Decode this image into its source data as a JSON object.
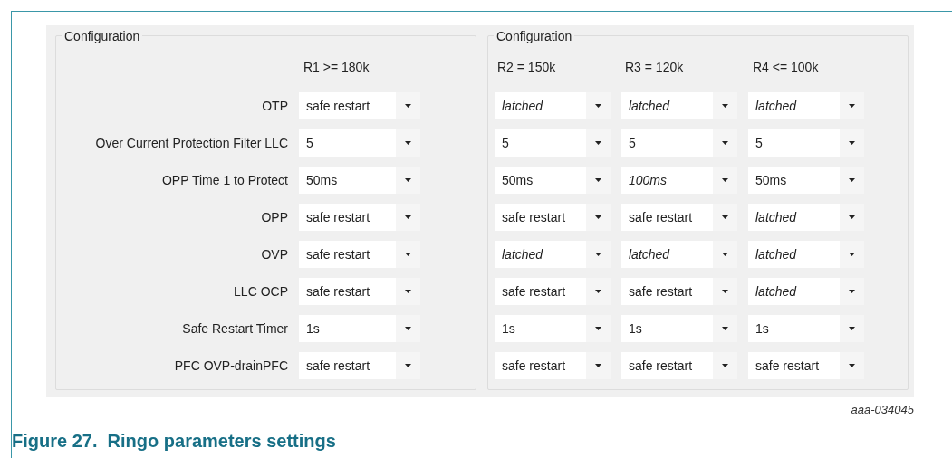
{
  "groups": [
    {
      "title": "Configuration",
      "columns": [
        "R1 >= 180k"
      ],
      "rows": [
        {
          "label": "OTP",
          "cells": [
            {
              "value": "safe restart",
              "italic": false
            }
          ]
        },
        {
          "label": "Over Current Protection Filter LLC",
          "cells": [
            {
              "value": "5",
              "italic": false
            }
          ]
        },
        {
          "label": "OPP Time 1 to Protect",
          "cells": [
            {
              "value": "50ms",
              "italic": false
            }
          ]
        },
        {
          "label": "OPP",
          "cells": [
            {
              "value": "safe restart",
              "italic": false
            }
          ]
        },
        {
          "label": "OVP",
          "cells": [
            {
              "value": "safe restart",
              "italic": false
            }
          ]
        },
        {
          "label": "LLC OCP",
          "cells": [
            {
              "value": "safe restart",
              "italic": false
            }
          ]
        },
        {
          "label": "Safe Restart Timer",
          "cells": [
            {
              "value": "1s",
              "italic": false
            }
          ]
        },
        {
          "label": "PFC OVP-drainPFC",
          "cells": [
            {
              "value": "safe restart",
              "italic": false
            }
          ]
        }
      ]
    },
    {
      "title": "Configuration",
      "columns": [
        "R2 = 150k",
        "R3 = 120k",
        "R4 <= 100k"
      ],
      "rows": [
        {
          "cells": [
            {
              "value": "latched",
              "italic": true
            },
            {
              "value": "latched",
              "italic": true
            },
            {
              "value": "latched",
              "italic": true
            }
          ]
        },
        {
          "cells": [
            {
              "value": "5",
              "italic": false
            },
            {
              "value": "5",
              "italic": false
            },
            {
              "value": "5",
              "italic": false
            }
          ]
        },
        {
          "cells": [
            {
              "value": "50ms",
              "italic": false
            },
            {
              "value": "100ms",
              "italic": true
            },
            {
              "value": "50ms",
              "italic": false
            }
          ]
        },
        {
          "cells": [
            {
              "value": "safe restart",
              "italic": false
            },
            {
              "value": "safe restart",
              "italic": false
            },
            {
              "value": "latched",
              "italic": true
            }
          ]
        },
        {
          "cells": [
            {
              "value": "latched",
              "italic": true
            },
            {
              "value": "latched",
              "italic": true
            },
            {
              "value": "latched",
              "italic": true
            }
          ]
        },
        {
          "cells": [
            {
              "value": "safe restart",
              "italic": false
            },
            {
              "value": "safe restart",
              "italic": false
            },
            {
              "value": "latched",
              "italic": true
            }
          ]
        },
        {
          "cells": [
            {
              "value": "1s",
              "italic": false
            },
            {
              "value": "1s",
              "italic": false
            },
            {
              "value": "1s",
              "italic": false
            }
          ]
        },
        {
          "cells": [
            {
              "value": "safe restart",
              "italic": false
            },
            {
              "value": "safe restart",
              "italic": false
            },
            {
              "value": "safe restart",
              "italic": false
            }
          ]
        }
      ]
    }
  ],
  "figure_id": "aaa-034045",
  "caption": "Figure 27.  Ringo parameters settings"
}
